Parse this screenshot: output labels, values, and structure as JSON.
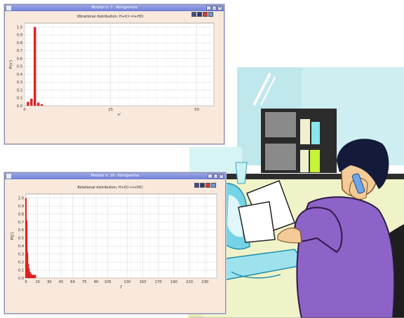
{
  "windows": [
    {
      "title": "Monitor n. 7 - Kemgamma",
      "chart_title": "Vibrational distribution: H+ICl->I+HCl",
      "ylabel": "P(v')",
      "xlabel": "v'",
      "xticks": [
        "0",
        "25",
        "50"
      ],
      "yticks": [
        "1.0",
        "0.9",
        "0.8",
        "0.7",
        "0.6",
        "0.5",
        "0.4",
        "0.3",
        "0.2",
        "0.1",
        "0.0"
      ]
    },
    {
      "title": "Monitor n. 18 - Kemgamma",
      "chart_title": "Rotational distribution: H+ICl->I+HCl",
      "ylabel": "P(j')",
      "xlabel": "j'",
      "xticks": [
        "0",
        "15",
        "30",
        "45",
        "60",
        "75",
        "90",
        "105",
        "130",
        "150",
        "170",
        "190",
        "210",
        "230"
      ],
      "yticks": [
        "1.0",
        "0.9",
        "0.8",
        "0.7",
        "0.6",
        "0.5",
        "0.4",
        "0.3",
        "0.2",
        "0.1",
        "0.0"
      ]
    }
  ],
  "chart_data": [
    {
      "type": "bar",
      "title": "Vibrational distribution: H+ICl->I+HCl",
      "xlabel": "v'",
      "ylabel": "P(v')",
      "xlim": [
        0,
        55
      ],
      "ylim": [
        0,
        1.05
      ],
      "x": [
        1,
        2,
        3,
        4,
        5
      ],
      "values": [
        0.05,
        0.09,
        1.0,
        0.04,
        0.02
      ],
      "color": "#e02020",
      "grid": true
    },
    {
      "type": "bar",
      "title": "Rotational distribution: H+ICl->I+HCl",
      "xlabel": "j'",
      "ylabel": "P(j')",
      "xlim": [
        0,
        245
      ],
      "ylim": [
        0,
        1.05
      ],
      "x": [
        0,
        1,
        2,
        3,
        4,
        5,
        6,
        7,
        8,
        9,
        10,
        11,
        12
      ],
      "values": [
        1.0,
        0.72,
        0.32,
        0.18,
        0.12,
        0.08,
        0.06,
        0.05,
        0.04,
        0.04,
        0.04,
        0.04,
        0.04
      ],
      "color": "#e02020",
      "grid": true
    }
  ],
  "colors": {
    "titlebar": "#7f8fde",
    "window_bg": "#f9e9dc",
    "bar": "#e02020",
    "shirt": "#8e63c7",
    "hair": "#131a3a",
    "skin": "#f4ca96",
    "wall": "#cfeef2"
  },
  "icons": [
    "window-menu-icon",
    "minimize-icon",
    "maximize-icon",
    "close-icon",
    "save-icon",
    "print-icon",
    "zoom-icon",
    "settings-icon"
  ]
}
